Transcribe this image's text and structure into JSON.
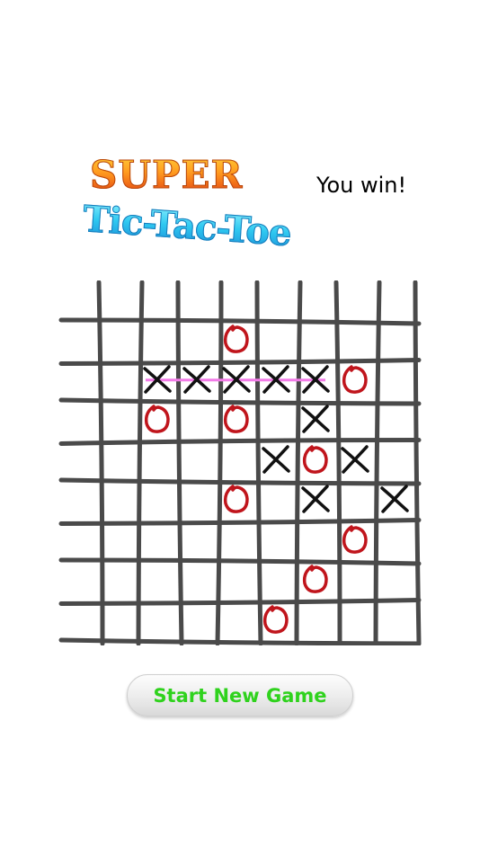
{
  "logo": {
    "line1": "SUPER",
    "line2": "Tic-Tac-Toe"
  },
  "status": "You win!",
  "start_button": "Start New Game",
  "colors": {
    "x_mark": "#111111",
    "o_mark": "#c0151c",
    "win_line": "#f27be8",
    "grid_line": "#4a4a4a",
    "button_text": "#2fd21d"
  },
  "board": {
    "cols": 8,
    "rows": 8,
    "marks": [
      {
        "r": 0,
        "c": 3,
        "m": "O"
      },
      {
        "r": 1,
        "c": 1,
        "m": "X"
      },
      {
        "r": 1,
        "c": 2,
        "m": "X"
      },
      {
        "r": 1,
        "c": 3,
        "m": "X"
      },
      {
        "r": 1,
        "c": 4,
        "m": "X"
      },
      {
        "r": 1,
        "c": 5,
        "m": "X"
      },
      {
        "r": 1,
        "c": 6,
        "m": "O"
      },
      {
        "r": 2,
        "c": 1,
        "m": "O"
      },
      {
        "r": 2,
        "c": 3,
        "m": "O"
      },
      {
        "r": 2,
        "c": 5,
        "m": "X"
      },
      {
        "r": 3,
        "c": 4,
        "m": "X"
      },
      {
        "r": 3,
        "c": 5,
        "m": "O"
      },
      {
        "r": 3,
        "c": 6,
        "m": "X"
      },
      {
        "r": 4,
        "c": 3,
        "m": "O"
      },
      {
        "r": 4,
        "c": 5,
        "m": "X"
      },
      {
        "r": 4,
        "c": 7,
        "m": "X"
      },
      {
        "r": 5,
        "c": 6,
        "m": "O"
      },
      {
        "r": 6,
        "c": 5,
        "m": "O"
      },
      {
        "r": 7,
        "c": 4,
        "m": "O"
      }
    ],
    "winning_line": {
      "row": 1,
      "from_col": 1,
      "to_col": 5
    }
  }
}
